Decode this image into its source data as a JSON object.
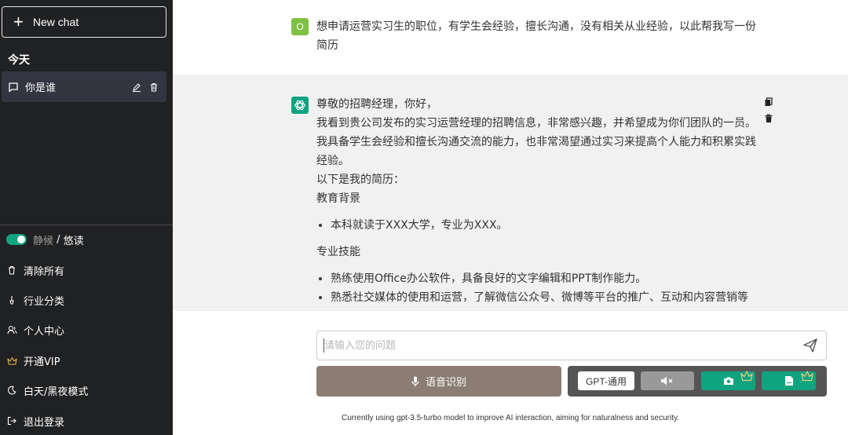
{
  "sidebar": {
    "new_chat_label": "New chat",
    "section_today": "今天",
    "chats": [
      {
        "title": "你是谁"
      }
    ],
    "menu": {
      "toggle_quiet": "静候",
      "toggle_sep": " / ",
      "toggle_read": "悠读",
      "clear_all": "清除所有",
      "industry": "行业分类",
      "profile": "个人中心",
      "vip": "开通VIP",
      "theme": "白天/黑夜模式",
      "logout": "退出登录"
    }
  },
  "conversation": {
    "user": {
      "avatar_letter": "O",
      "message": "想申请运营实习生的职位，有学生会经验，擅长沟通，没有相关从业经验，以此帮我写一份简历"
    },
    "assistant": {
      "line1": "尊敬的招聘经理，你好，",
      "line2": "我看到贵公司发布的实习运营经理的招聘信息，非常感兴趣，并希望成为你们团队的一员。",
      "line3": "我具备学生会经验和擅长沟通交流的能力，也非常渴望通过实习来提高个人能力和积累实践经验。",
      "line4": "以下是我的简历：",
      "edu_heading": "教育背景",
      "edu_item": "本科就读于XXX大学，专业为XXX。",
      "skills_heading": "专业技能",
      "skill1": "熟练使用Office办公软件，具备良好的文字编辑和PPT制作能力。",
      "skill2": "熟悉社交媒体的使用和运营，了解微信公众号、微博等平台的推广、互动和内容营销等"
    }
  },
  "composer": {
    "placeholder": "请输入您的问题",
    "voice_label": "语音识别",
    "model_label": "GPT-通用"
  },
  "footer": {
    "note": "Currently using gpt-3.5-turbo model to improve AI interaction, aiming for naturalness and security."
  },
  "colors": {
    "sidebar_bg": "#202123",
    "accent": "#10a37f",
    "voice_button": "#8b7d73",
    "vip_gold": "#e8b64a"
  }
}
